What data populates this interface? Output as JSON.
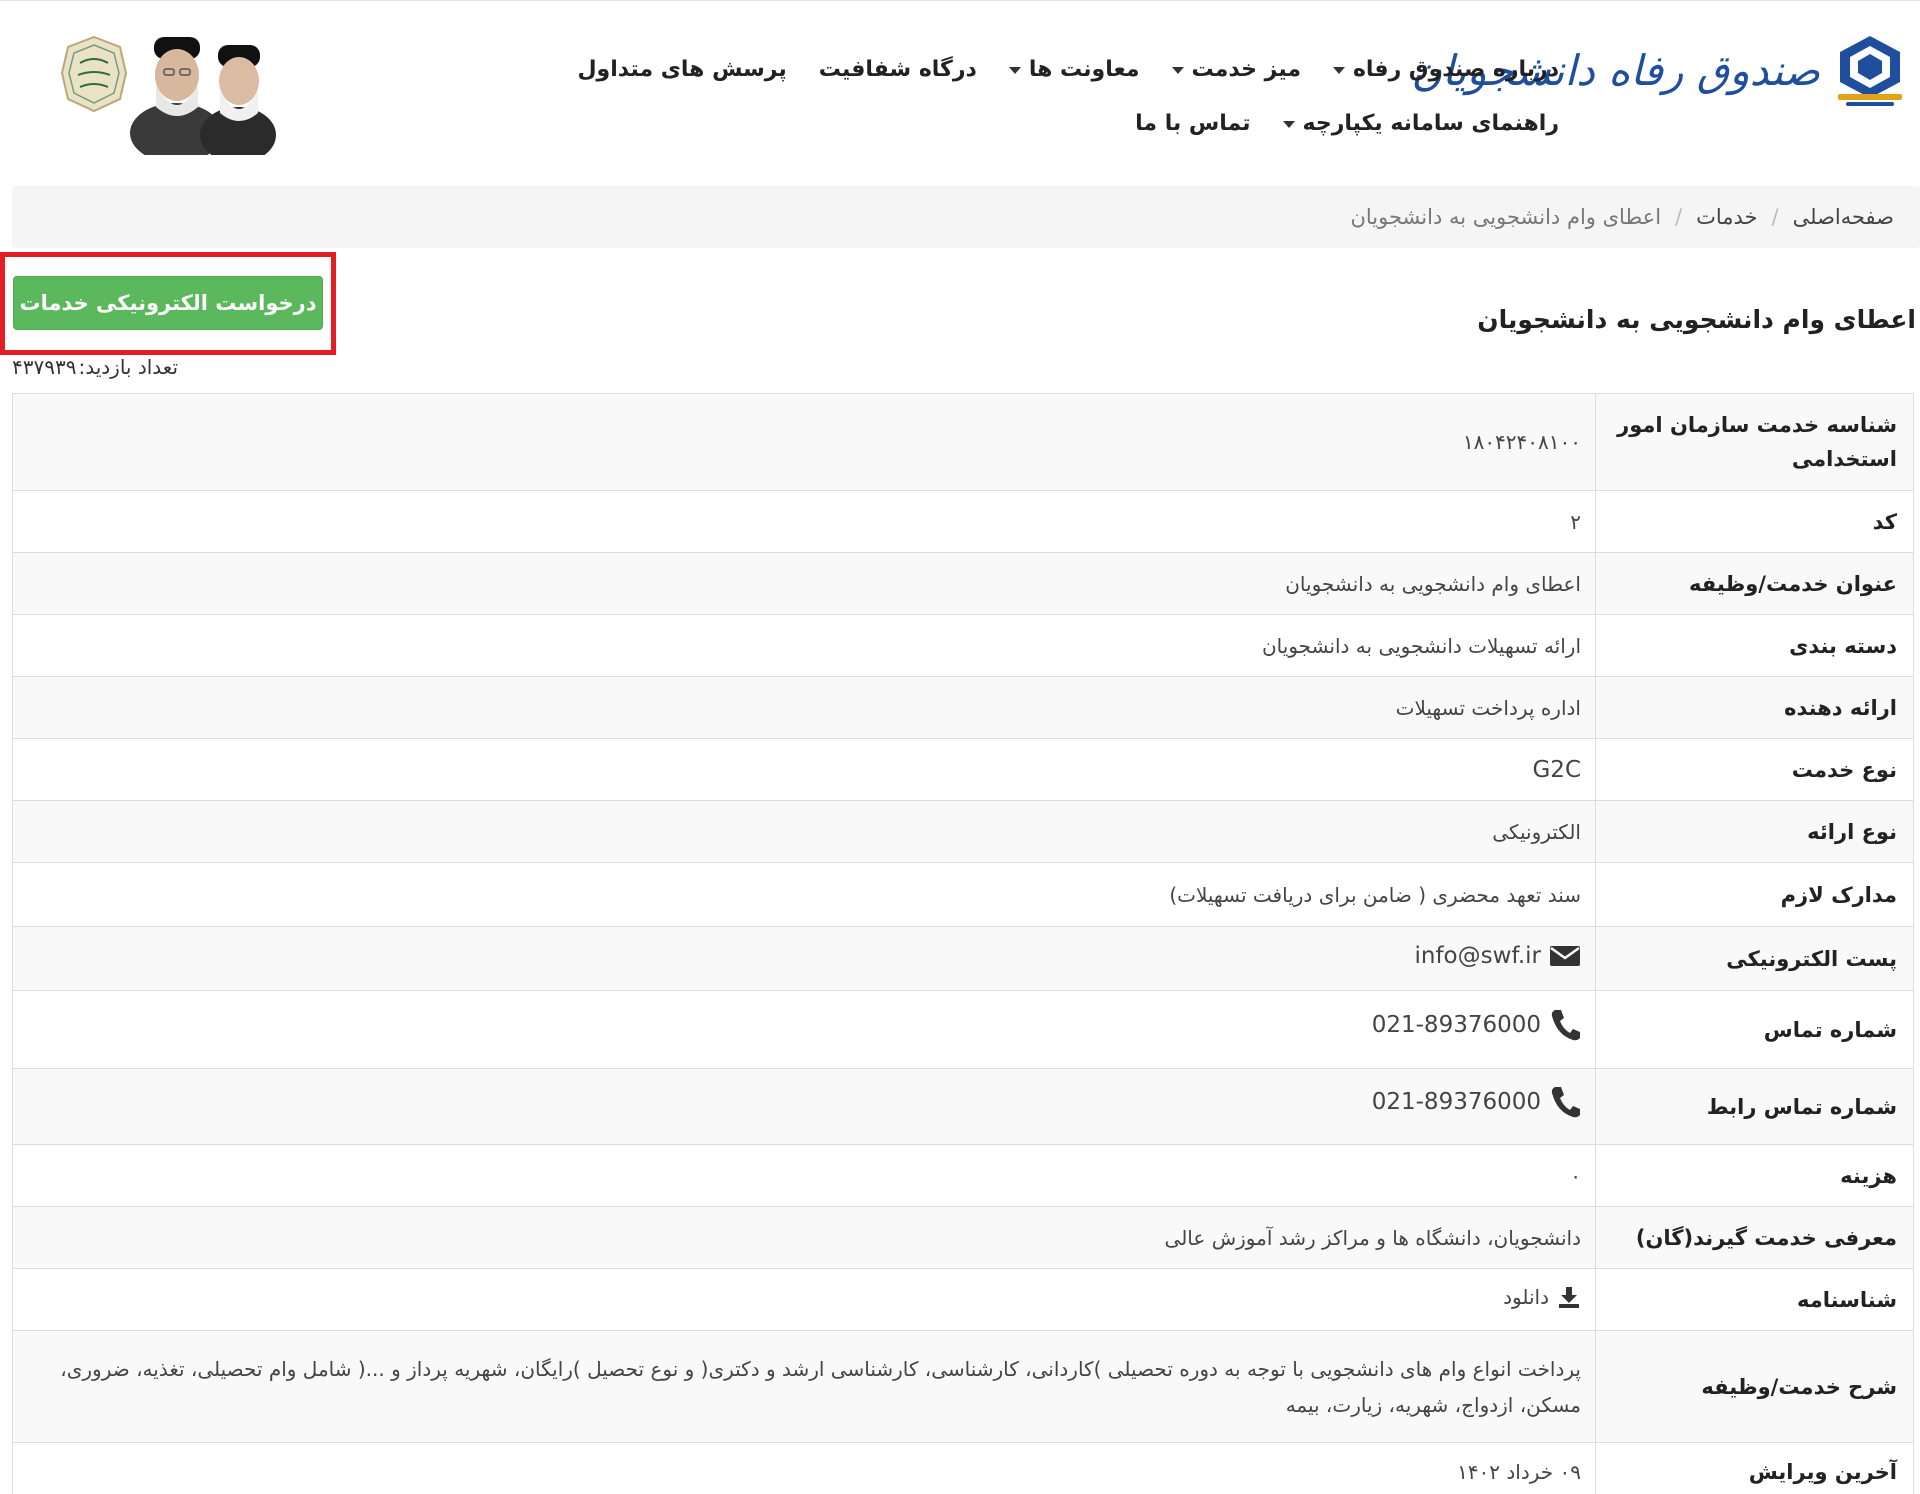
{
  "brand": {
    "name": "صندوق رفاه دانشجویان",
    "emblem_text": "مهار تورم رشد تولید"
  },
  "nav": {
    "items": [
      {
        "label": "درباره صندوق رفاه",
        "dropdown": true
      },
      {
        "label": "میز خدمت",
        "dropdown": true
      },
      {
        "label": "معاونت ها",
        "dropdown": true
      },
      {
        "label": "درگاه شفافیت",
        "dropdown": false
      },
      {
        "label": "پرسش های متداول",
        "dropdown": false
      },
      {
        "label": "راهنمای سامانه یکپارچه",
        "dropdown": true
      },
      {
        "label": "تماس با ما",
        "dropdown": false
      }
    ]
  },
  "breadcrumb": {
    "home": "صفحه‌اصلی",
    "section": "خدمات",
    "current": "اعطای وام دانشجویی به دانشجویان"
  },
  "page": {
    "title": "اعطای وام دانشجویی به دانشجویان",
    "request_button": "درخواست الکترونیکی خدمات",
    "visits_label": "تعداد بازدید:",
    "visits_value": "۴۳۷۹۳۹"
  },
  "details": {
    "rows": [
      {
        "label": "شناسه خدمت سازمان امور استخدامی",
        "value": "۱۸۰۴۲۴۰۸۱۰۰"
      },
      {
        "label": "کد",
        "value": "۲"
      },
      {
        "label": "عنوان خدمت/وظیفه",
        "value": "اعطای وام دانشجویی به دانشجویان"
      },
      {
        "label": "دسته بندی",
        "value": "ارائه تسهیلات دانشجویی به دانشجویان"
      },
      {
        "label": "ارائه دهنده",
        "value": "اداره پرداخت تسهیلات"
      },
      {
        "label": "نوع خدمت",
        "value": "G2C"
      },
      {
        "label": "نوع ارائه",
        "value": "الکترونیکی"
      },
      {
        "label": "مدارک لازم",
        "value": "سند تعهد محضری ( ضامن برای دریافت تسهیلات)"
      },
      {
        "label": "پست الکترونیکی",
        "value": "info@swf.ir",
        "icon": "envelope-icon"
      },
      {
        "label": "شماره تماس",
        "value": "021-89376000",
        "icon": "phone-icon"
      },
      {
        "label": "شماره تماس رابط",
        "value": "021-89376000",
        "icon": "phone-icon"
      },
      {
        "label": "هزینه",
        "value": "۰"
      },
      {
        "label": "معرفی خدمت گیرند(گان)",
        "value": "دانشجویان، دانشگاه ها و مراکز رشد آموزش عالی"
      },
      {
        "label": "شناسنامه",
        "value": "دانلود",
        "icon": "download-icon"
      },
      {
        "label": "شرح خدمت/وظیفه",
        "value": "پرداخت انواع وام های دانشجویی با توجه به دوره تحصیلی )کاردانی، کارشناسی، کارشناسی ارشد و دکتری( و نوع تحصیل )رایگان، شهریه پرداز و ...( شامل وام تحصیلی، تغذیه، ضروری، مسکن، ازدواج، شهریه، زیارت، بیمه"
      },
      {
        "label": "آخرین ویرایش",
        "value": "۰۹ خرداد ۱۴۰۲"
      }
    ]
  },
  "colors": {
    "brand_blue": "#1f4e9c",
    "brand_gold": "#e2a21a",
    "button_green": "#5cb85c",
    "highlight_red": "#e31e24"
  }
}
